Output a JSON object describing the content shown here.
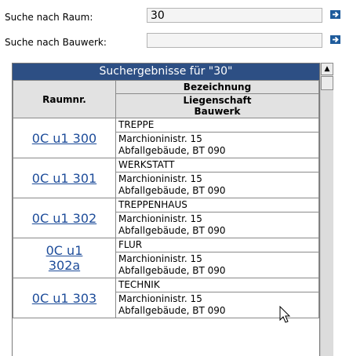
{
  "search": {
    "room_label": "Suche nach Raum:",
    "room_value": "30",
    "building_label": "Suche nach Bauwerk:",
    "building_value": ""
  },
  "results": {
    "title": "Suchergebnisse für \"30\"",
    "header": {
      "col1": "Raumnr.",
      "col2_top": "Bezeichnung",
      "col2_bottom_line1": "Liegenschaft",
      "col2_bottom_line2": "Bauwerk"
    },
    "rows": [
      {
        "room": "0C u1 300",
        "name": "TREPPE",
        "property": "Marchioninistr. 15",
        "building": "Abfallgebäude, BT 090"
      },
      {
        "room": "0C u1 301",
        "name": "WERKSTATT",
        "property": "Marchioninistr. 15",
        "building": "Abfallgebäude, BT 090"
      },
      {
        "room": "0C u1 302",
        "name": "TREPPENHAUS",
        "property": "Marchioninistr. 15",
        "building": "Abfallgebäude, BT 090"
      },
      {
        "room": "0C u1 302a",
        "name": "FLUR",
        "property": "Marchioninistr. 15",
        "building": "Abfallgebäude, BT 090"
      },
      {
        "room": "0C u1 303",
        "name": "TECHNIK",
        "property": "Marchioninistr. 15",
        "building": "Abfallgebäude, BT 090"
      }
    ]
  },
  "icons": {
    "go": "arrow-right-icon",
    "scroll_up": "scroll-up-arrow-icon",
    "cursor": "mouse-pointer-icon"
  },
  "colors": {
    "title_bar": "#2d4f84",
    "link": "#1d4c9a",
    "header_bg": "#e2e2e2"
  }
}
